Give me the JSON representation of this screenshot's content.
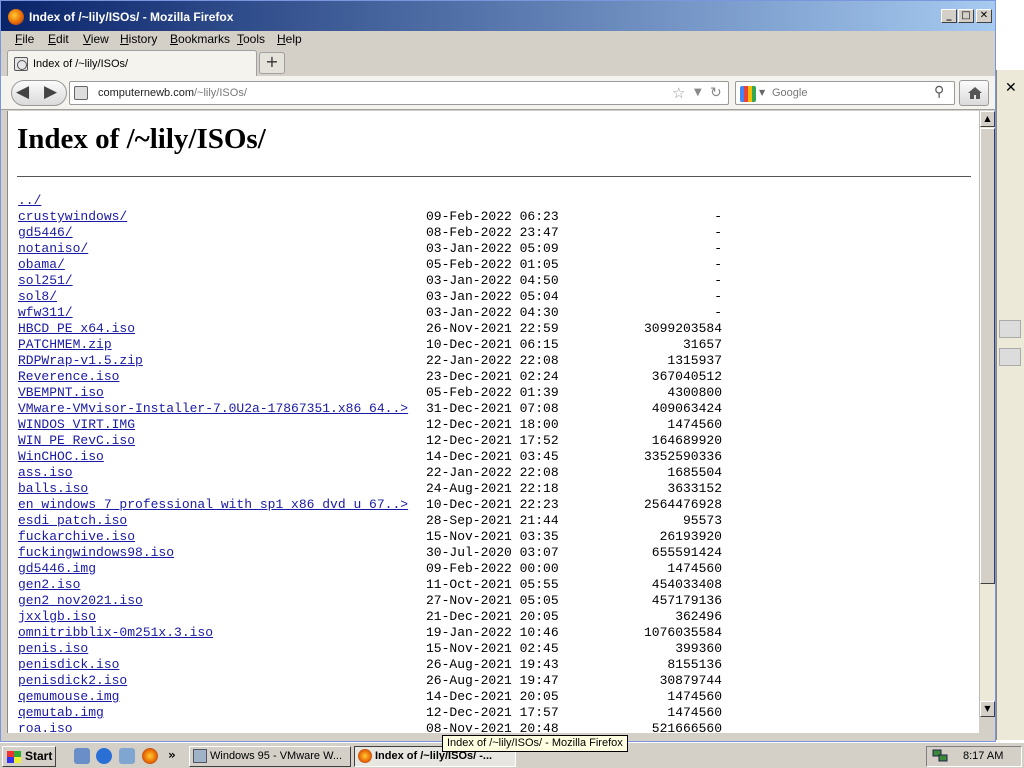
{
  "window": {
    "title": "Index of /~lily/ISOs/ - Mozilla Firefox",
    "min": "_",
    "max": "□",
    "close": "✕"
  },
  "menu": [
    "File",
    "Edit",
    "View",
    "History",
    "Bookmarks",
    "Tools",
    "Help"
  ],
  "tab": {
    "label": "Index of /~lily/ISOs/",
    "newtab": "+"
  },
  "nav": {
    "back": "◀",
    "forward": "▶",
    "url_host": "computernewb.com",
    "url_path": "/~lily/ISOs/",
    "star": "☆",
    "drop": "▼",
    "reload": "↻",
    "search_placeholder": "Google",
    "search_icon": "⚲"
  },
  "page": {
    "heading": "Index of /~lily/ISOs/",
    "entries": [
      {
        "name": "../",
        "date": "",
        "size": ""
      },
      {
        "name": "crustywindows/",
        "date": "09-Feb-2022 06:23",
        "size": "-"
      },
      {
        "name": "gd5446/",
        "date": "08-Feb-2022 23:47",
        "size": "-"
      },
      {
        "name": "notaniso/",
        "date": "03-Jan-2022 05:09",
        "size": "-"
      },
      {
        "name": "obama/",
        "date": "05-Feb-2022 01:05",
        "size": "-"
      },
      {
        "name": "sol251/",
        "date": "03-Jan-2022 04:50",
        "size": "-"
      },
      {
        "name": "sol8/",
        "date": "03-Jan-2022 05:04",
        "size": "-"
      },
      {
        "name": "wfw311/",
        "date": "03-Jan-2022 04:30",
        "size": "-"
      },
      {
        "name": "HBCD PE x64.iso",
        "date": "26-Nov-2021 22:59",
        "size": "3099203584"
      },
      {
        "name": "PATCHMEM.zip",
        "date": "10-Dec-2021 06:15",
        "size": "31657"
      },
      {
        "name": "RDPWrap-v1.5.zip",
        "date": "22-Jan-2022 22:08",
        "size": "1315937"
      },
      {
        "name": "Reverence.iso",
        "date": "23-Dec-2021 02:24",
        "size": "367040512"
      },
      {
        "name": "VBEMPNT.iso",
        "date": "05-Feb-2022 01:39",
        "size": "4300800"
      },
      {
        "name": "VMware-VMvisor-Installer-7.0U2a-17867351.x86 64..>",
        "date": "31-Dec-2021 07:08",
        "size": "409063424"
      },
      {
        "name": "WINDOS VIRT.IMG",
        "date": "12-Dec-2021 18:00",
        "size": "1474560"
      },
      {
        "name": "WIN PE RevC.iso",
        "date": "12-Dec-2021 17:52",
        "size": "164689920"
      },
      {
        "name": "WinCHOC.iso",
        "date": "14-Dec-2021 03:45",
        "size": "3352590336"
      },
      {
        "name": "ass.iso",
        "date": "22-Jan-2022 22:08",
        "size": "1685504"
      },
      {
        "name": "balls.iso",
        "date": "24-Aug-2021 22:18",
        "size": "3633152"
      },
      {
        "name": "en windows 7 professional with sp1 x86 dvd u 67..>",
        "date": "10-Dec-2021 22:23",
        "size": "2564476928"
      },
      {
        "name": "esdi patch.iso",
        "date": "28-Sep-2021 21:44",
        "size": "95573"
      },
      {
        "name": "fuckarchive.iso",
        "date": "15-Nov-2021 03:35",
        "size": "26193920"
      },
      {
        "name": "fuckingwindows98.iso",
        "date": "30-Jul-2020 03:07",
        "size": "655591424"
      },
      {
        "name": "gd5446.img",
        "date": "09-Feb-2022 00:00",
        "size": "1474560"
      },
      {
        "name": "gen2.iso",
        "date": "11-Oct-2021 05:55",
        "size": "454033408"
      },
      {
        "name": "gen2 nov2021.iso",
        "date": "27-Nov-2021 05:05",
        "size": "457179136"
      },
      {
        "name": "jxxlgb.iso",
        "date": "21-Dec-2021 20:05",
        "size": "362496"
      },
      {
        "name": "omnitribblix-0m251x.3.iso",
        "date": "19-Jan-2022 10:46",
        "size": "1076035584"
      },
      {
        "name": "penis.iso",
        "date": "15-Nov-2021 02:45",
        "size": "399360"
      },
      {
        "name": "penisdick.iso",
        "date": "26-Aug-2021 19:43",
        "size": "8155136"
      },
      {
        "name": "penisdick2.iso",
        "date": "26-Aug-2021 19:47",
        "size": "30879744"
      },
      {
        "name": "qemumouse.img",
        "date": "14-Dec-2021 20:05",
        "size": "1474560"
      },
      {
        "name": "qemutab.img",
        "date": "12-Dec-2021 17:57",
        "size": "1474560"
      },
      {
        "name": "roa.iso",
        "date": "08-Nov-2021 20:48",
        "size": "521666560"
      }
    ]
  },
  "tooltip": "Index of /~lily/ISOs/ - Mozilla Firefox",
  "taskbar": {
    "start": "Start",
    "task1": "Windows 95 - VMware W...",
    "task2": "Index of /~lily/ISOs/ -...",
    "clock": "8:17 AM",
    "quicklaunch_more": "»"
  },
  "bg_window": {
    "close": "✕"
  }
}
